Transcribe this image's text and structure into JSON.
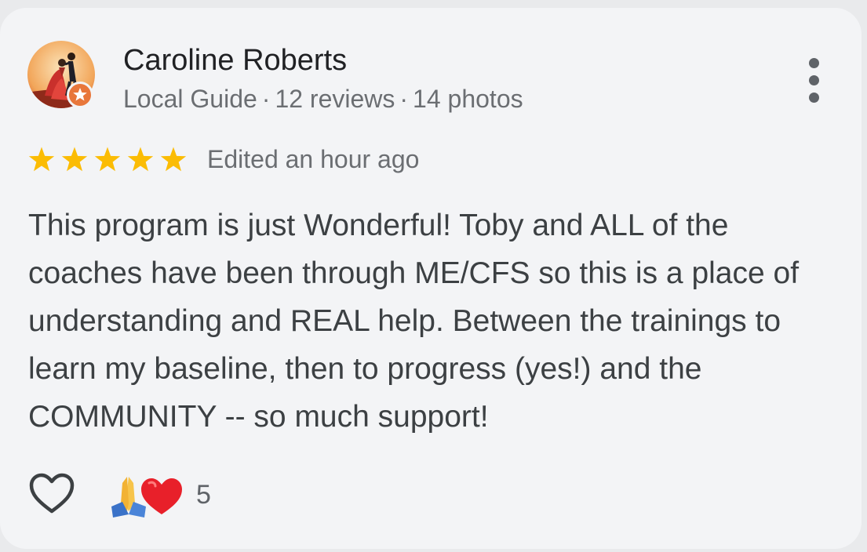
{
  "review": {
    "author": {
      "name": "Caroline Roberts",
      "badge": "Local Guide",
      "reviews": "12 reviews",
      "photos": "14 photos",
      "avatar_icon": "dancing-couple-avatar",
      "badge_icon": "local-guide-star-badge"
    },
    "rating": {
      "stars": 5,
      "max_stars": 5,
      "star_color": "#fbbc04"
    },
    "edited": "Edited an hour ago",
    "text": "This program is just Wonderful! Toby and ALL of the coaches have been through ME/CFS so this is a place of understanding and REAL help. Between the trainings to learn my baseline, then to progress (yes!) and the COMMUNITY -- so much support!",
    "reactions": {
      "emojis": [
        "folded-hands-emoji",
        "red-heart-emoji"
      ],
      "count": "5"
    },
    "actions": {
      "like_icon": "heart-outline-icon",
      "more_icon": "more-vert-icon"
    }
  },
  "colors": {
    "card_background": "#f3f4f6",
    "primary_text": "#202124",
    "secondary_text": "#6b6e72",
    "badge_orange": "#e8773b"
  }
}
